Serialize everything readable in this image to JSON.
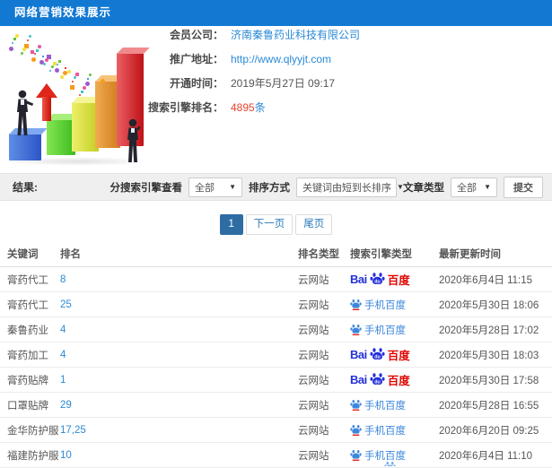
{
  "header": {
    "title": "网络营销效果展示"
  },
  "info": {
    "company": {
      "label": "会员公司：",
      "value": "济南秦鲁药业科技有限公司"
    },
    "url": {
      "label": "推广地址：",
      "value": "http://www.qlyyjt.com"
    },
    "opened": {
      "label": "开通时间：",
      "value": "2019年5月27日 09:17"
    },
    "rank": {
      "label": "搜索引擎排名：",
      "count": "4895",
      "unit": "条"
    }
  },
  "filters": {
    "result_label": "结果:",
    "engine_label": "分搜索引擎查看",
    "engine_value": "全部",
    "sort_label": "排序方式",
    "sort_value": "关键词由短到长排序",
    "article_label": "文章类型",
    "article_value": "全部",
    "submit_label": "提交"
  },
  "pagination": {
    "current": "1",
    "next": "下一页",
    "last": "尾页"
  },
  "table": {
    "headers": [
      "关键词",
      "排名",
      "排名类型",
      "搜索引擎类型",
      "最新更新时间"
    ],
    "rows": [
      {
        "keyword": "膏药代工",
        "rank": "8",
        "rank_type": "云网站",
        "engine": "baidu_pc",
        "updated": "2020年6月4日 11:15"
      },
      {
        "keyword": "膏药代工",
        "rank": "25",
        "rank_type": "云网站",
        "engine": "baidu_mobile",
        "updated": "2020年5月30日 18:06"
      },
      {
        "keyword": "秦鲁药业",
        "rank": "4",
        "rank_type": "云网站",
        "engine": "baidu_mobile",
        "updated": "2020年5月28日 17:02"
      },
      {
        "keyword": "膏药加工",
        "rank": "4",
        "rank_type": "云网站",
        "engine": "baidu_pc",
        "updated": "2020年5月30日 18:03"
      },
      {
        "keyword": "膏药贴牌",
        "rank": "1",
        "rank_type": "云网站",
        "engine": "baidu_pc",
        "updated": "2020年5月30日 17:58"
      },
      {
        "keyword": "口罩贴牌",
        "rank": "29",
        "rank_type": "云网站",
        "engine": "baidu_mobile",
        "updated": "2020年5月28日 16:55"
      },
      {
        "keyword": "金华防护服",
        "rank": "17,25",
        "rank_type": "云网站",
        "engine": "baidu_mobile",
        "updated": "2020年6月20日 09:25"
      },
      {
        "keyword": "福建防护服",
        "rank": "10",
        "rank_type": "云网站",
        "engine": "baidu_mobile",
        "updated": "2020年6月4日 11:10"
      }
    ]
  },
  "engines": {
    "baidu_pc": {
      "bai": "Bai",
      "paw_text": "du",
      "du": "百度"
    },
    "baidu_mobile": {
      "text": "手机百度"
    }
  },
  "colors": {
    "titlebar": "#1279d2",
    "link": "#2b8ad6",
    "count_red": "#e6432e",
    "active_page": "#2e6da4",
    "baidu_blue": "#2431d8",
    "baidu_red": "#e10500",
    "mobile_blue": "#3c87dd",
    "confetti": [
      "#e6332a",
      "#f59b1e",
      "#f2e23a",
      "#67c23a",
      "#3a9de0",
      "#9b59d0",
      "#e85a9b",
      "#40c8c8"
    ]
  }
}
